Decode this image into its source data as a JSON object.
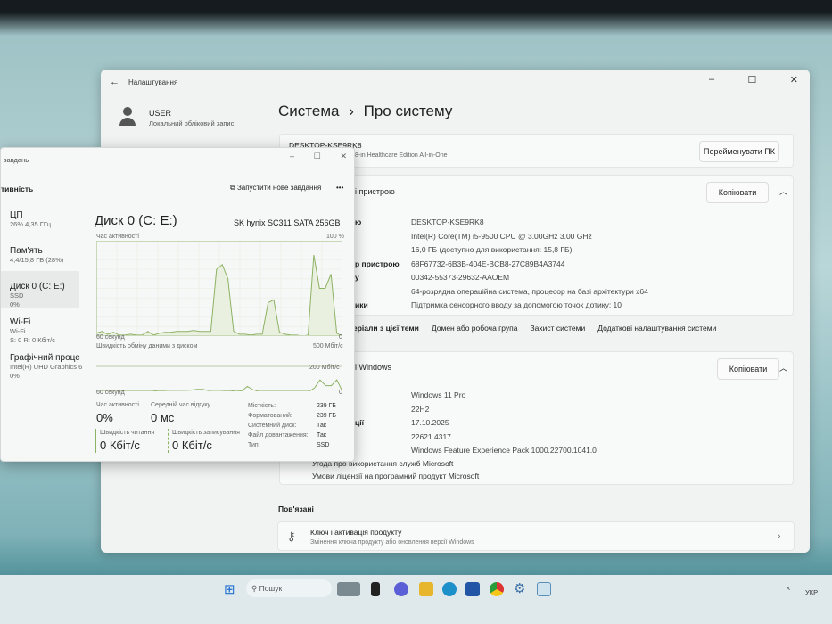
{
  "settings": {
    "title": "Налаштування",
    "user_name": "USER",
    "user_sub": "Локальний обліковий запис",
    "breadcrumb_parent": "Система",
    "breadcrumb_sep": "›",
    "breadcrumb_current": "Про систему",
    "device_name": "DESKTOP-KSE9RK8",
    "device_model": "8-in Healthcare Edition All-in-One",
    "rename_button": "Перейменувати ПК",
    "device_spec_title": "і пристрою",
    "copy_button": "Копіювати",
    "device_specs": [
      {
        "label": "ю",
        "value": "DESKTOP-KSE9RK8"
      },
      {
        "label": "",
        "value": "Intel(R) Core(TM) i5-9500 CPU @ 3.00GHz   3.00 GHz"
      },
      {
        "label": "",
        "value": "16,0 ГБ (доступно для використання: 15,8 ГБ)"
      },
      {
        "label": "р пристрою",
        "value": "68F67732-6B3B-404E-BCB8-27C89B4A3744"
      },
      {
        "label": "у",
        "value": "00342-55373-29632-AAOEM"
      },
      {
        "label": "",
        "value": "64-розрядна операційна система, процесор на базі архітектури x64"
      },
      {
        "label": "ики",
        "value": "Підтримка сенсорного вводу за допомогою точок дотику: 10"
      }
    ],
    "links": [
      "еріали з цієї теми",
      "Домен або робоча група",
      "Захист системи",
      "Додаткові налаштування системи"
    ],
    "windows_spec_title": "і Windows",
    "windows_specs": [
      {
        "label": "",
        "value": "Windows 11 Pro"
      },
      {
        "label": "",
        "value": "22H2"
      },
      {
        "label": "ції",
        "value": "17.10.2025"
      },
      {
        "label": "",
        "value": "22621.4317"
      },
      {
        "label": "",
        "value": "Windows Feature Experience Pack 1000.22700.1041.0"
      }
    ],
    "ms_links": [
      "Угода про використання служб Microsoft",
      "Умови ліцензії на програмний продукт Microsoft"
    ],
    "related_title": "Пов'язані",
    "related_item": {
      "title": "Ключ і активація продукту",
      "sub": "Змінення ключа продукту або оновлення версії Windows"
    }
  },
  "taskmgr": {
    "title": "завдань",
    "section": "тивність",
    "run_task": "Запустити нове завдання",
    "more": "•••",
    "sidebar": [
      {
        "name": "ЦП",
        "sub1": "26% 4,35 ГГц",
        "sub2": ""
      },
      {
        "name": "Пам'ять",
        "sub1": "4,4/15,8 ГБ (28%)",
        "sub2": ""
      },
      {
        "name": "Диск 0 (C: E:)",
        "sub1": "SSD",
        "sub2": "0%"
      },
      {
        "name": "Wi-Fi",
        "sub1": "Wi-Fi",
        "sub2": "S: 0 R: 0 Кбіт/с"
      },
      {
        "name": "Графічний проце",
        "sub1": "Intel(R) UHD Graphics 6",
        "sub2": "0%"
      }
    ],
    "disk_title": "Диск 0 (C: E:)",
    "disk_model": "SK hynix SC311 SATA 256GB",
    "activity_label": "Час активності",
    "activity_max": "100 %",
    "time_label": "60 секунд",
    "zero": "0",
    "transfer_label": "Швидкість обміну даними з диском",
    "transfer_max": "500 Мбіт/с",
    "transfer_mid": "200 Мбіт/с",
    "stats": {
      "active_label": "Час активності",
      "active": "0%",
      "resp_label": "Середній час відгуку",
      "resp": "0 мс",
      "read_label": "Швидкість читання",
      "read": "0 Кбіт/с",
      "write_label": "Швидкість записування",
      "write": "0 Кбіт/с"
    },
    "props": [
      {
        "k": "Місткість:",
        "v": "239 ГБ"
      },
      {
        "k": "Форматований:",
        "v": "239 ГБ"
      },
      {
        "k": "Системний диск:",
        "v": "Так"
      },
      {
        "k": "Файл довантаження:",
        "v": "Так"
      },
      {
        "k": "Тип:",
        "v": "SSD"
      }
    ],
    "activity_values": [
      3,
      5,
      2,
      4,
      1,
      1,
      2,
      1,
      1,
      5,
      1,
      3,
      4,
      4,
      5,
      5,
      5,
      6,
      5,
      5,
      5,
      70,
      75,
      60,
      5,
      2,
      2,
      1,
      2,
      2,
      35,
      38,
      4,
      2,
      1,
      1,
      0,
      1,
      85,
      50,
      50,
      65,
      3,
      0
    ],
    "transfer_values": [
      0,
      0,
      0,
      0,
      0,
      0,
      0,
      0,
      0,
      0,
      0,
      10,
      10,
      12,
      12,
      12,
      12,
      15,
      25,
      25,
      10,
      12,
      12,
      10,
      10,
      0,
      5,
      60,
      20,
      0,
      0,
      0,
      0,
      0,
      0,
      0,
      0,
      0,
      0,
      40,
      140,
      70,
      70,
      140,
      0
    ]
  },
  "taskbar": {
    "search": "Пошук",
    "lang": "УКР",
    "up": "^"
  }
}
